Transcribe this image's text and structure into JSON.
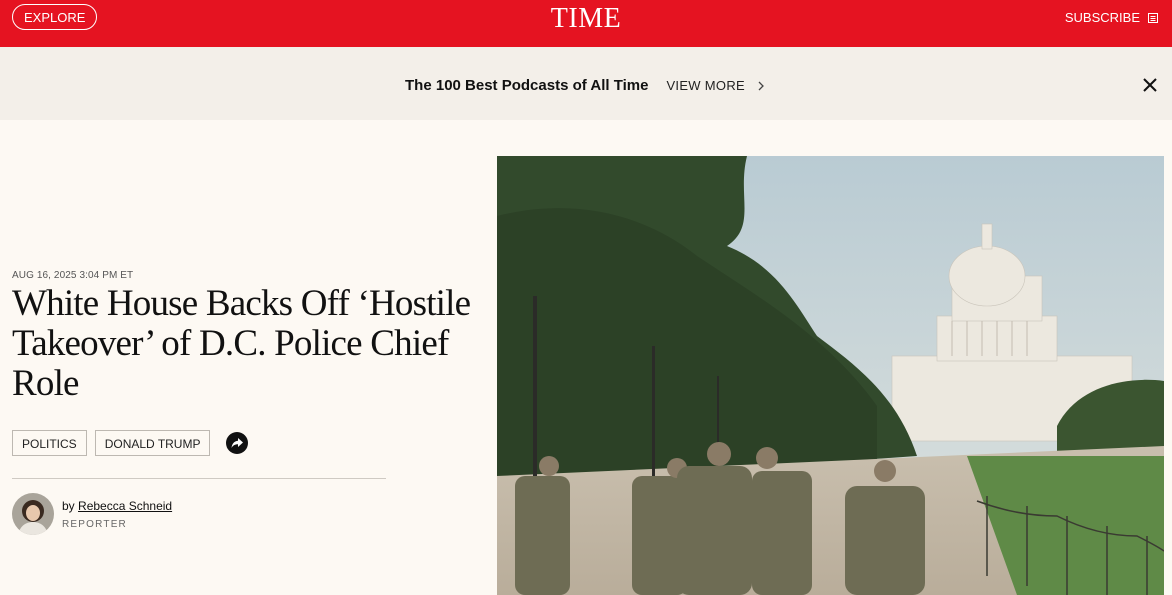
{
  "header": {
    "explore_label": "EXPLORE",
    "logo_text": "TIME",
    "subscribe_label": "SUBSCRIBE"
  },
  "banner": {
    "title": "The 100 Best Podcasts of All Time",
    "view_more_label": "VIEW MORE"
  },
  "article": {
    "date": "AUG 16, 2025 3:04 PM ET",
    "headline": "White House Backs Off ‘Hostile Takeover’ of D.C. Police Chief Role",
    "tags": [
      "POLITICS",
      "DONALD TRUMP"
    ],
    "author": {
      "by": "by",
      "name": "Rebecca Schneid",
      "role": "REPORTER"
    }
  },
  "colors": {
    "brand_red": "#e51321",
    "page_bg": "#fdf9f3",
    "banner_bg": "#f3efe9"
  },
  "icons": {
    "subscribe": "document-icon",
    "view_more": "chevron-right-icon",
    "close": "close-icon",
    "share": "share-arrow-icon"
  }
}
